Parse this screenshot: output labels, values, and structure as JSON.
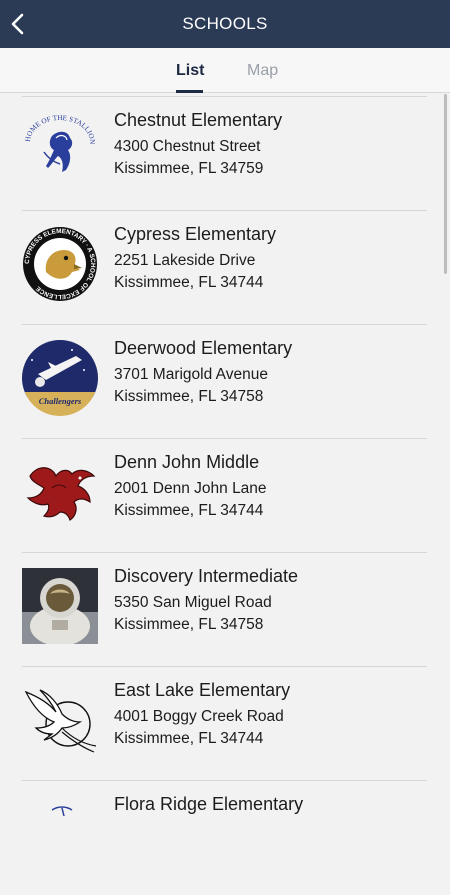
{
  "header": {
    "title": "SCHOOLS",
    "back_icon": "chevron-left-icon"
  },
  "tabs": [
    {
      "label": "List",
      "active": true
    },
    {
      "label": "Map",
      "active": false
    }
  ],
  "schools": [
    {
      "name": "Chestnut Elementary",
      "address": "4300 Chestnut Street",
      "city": "Kissimmee, FL 34759",
      "logo_text": "HOME OF THE STALLIONS"
    },
    {
      "name": "Cypress Elementary",
      "address": "2251 Lakeside Drive",
      "city": "Kissimmee, FL 34744",
      "logo_text": "CYPRESS ELEMENTARY · A SCHOOL OF EXCELLENCE"
    },
    {
      "name": "Deerwood Elementary",
      "address": "3701 Marigold Avenue",
      "city": "Kissimmee, FL 34758",
      "logo_text": "Challengers"
    },
    {
      "name": "Denn John Middle",
      "address": "2001 Denn John Lane",
      "city": "Kissimmee, FL 34744"
    },
    {
      "name": "Discovery Intermediate",
      "address": "5350 San Miguel Road",
      "city": "Kissimmee, FL 34758"
    },
    {
      "name": "East Lake Elementary",
      "address": "4001 Boggy Creek Road",
      "city": "Kissimmee, FL 34744"
    },
    {
      "name": "Flora Ridge Elementary",
      "address": "",
      "city": ""
    }
  ],
  "colors": {
    "header_bg": "#2b3a55",
    "tab_active": "#1d2a44",
    "tab_inactive": "#9aa0a8"
  }
}
